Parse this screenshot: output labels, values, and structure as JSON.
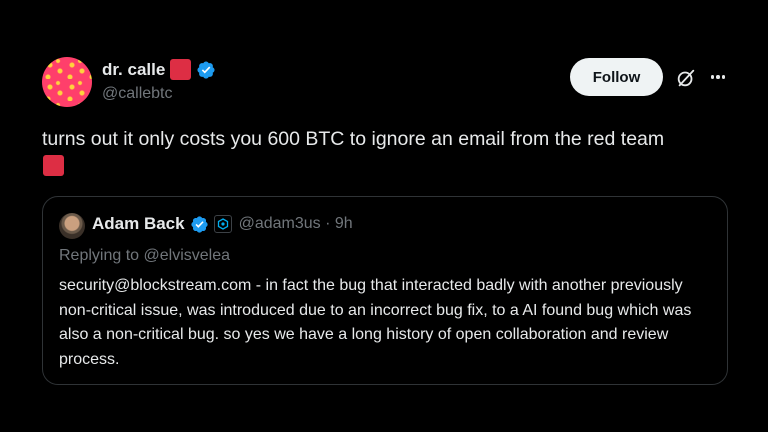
{
  "author": {
    "display_name": "dr. calle",
    "handle": "@callebtc",
    "name_emoji": "red-square-emoji",
    "verified": true
  },
  "actions": {
    "follow_label": "Follow",
    "grok_icon": "grok-icon",
    "more_icon": "more-icon"
  },
  "tweet": {
    "text": "turns out it only costs you 600 BTC to ignore an email from the red team",
    "trailing_emoji": "red-square-emoji"
  },
  "quote": {
    "display_name": "Adam Back",
    "handle_time": "@adam3us · 9h",
    "replying_to": "Replying to @elvisvelea",
    "body": "security@blockstream.com - in fact the bug that interacted badly with another previously non-critical issue, was introduced due to an incorrect bug fix, to a AI found bug which was also a non-critical bug. so yes we have a long history of open collaboration and review process.",
    "verified": true,
    "affiliate_icon": "blockstream-affiliate-icon"
  },
  "colors": {
    "background": "#000000",
    "text": "#e7e9ea",
    "muted": "#71767b",
    "verified_blue": "#1d9bf0",
    "red_square": "#dd2e44",
    "border": "#2f3336"
  }
}
